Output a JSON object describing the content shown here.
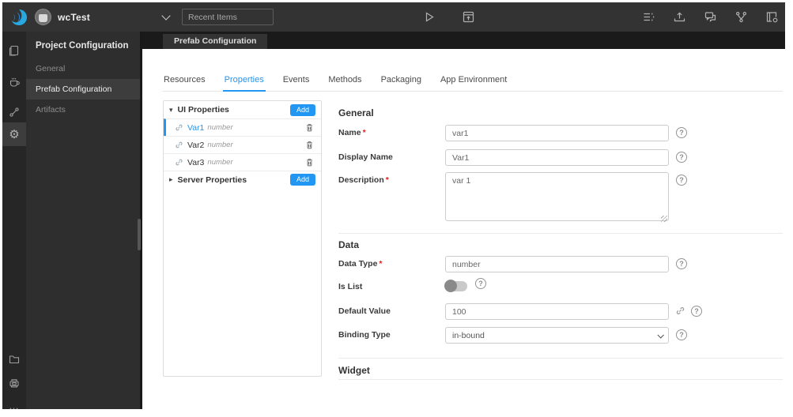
{
  "colors": {
    "accent": "#2196f3",
    "required": "#e02020",
    "topbar": "#333333",
    "rail": "#262626",
    "navpanel": "#2e2e2e",
    "tabstrip": "#1a1a1a"
  },
  "icons": {
    "help": "?",
    "more": "…",
    "gear": "⚙",
    "tri_down": "▾",
    "tri_right": "▸"
  },
  "topbar": {
    "project_name": "wcTest",
    "recent_placeholder": "Recent Items"
  },
  "config_nav": {
    "title": "Project Configuration",
    "items": [
      {
        "label": "General"
      },
      {
        "label": "Prefab Configuration"
      },
      {
        "label": "Artifacts"
      }
    ]
  },
  "workspace": {
    "open_tab": "Prefab Configuration",
    "tabs": [
      {
        "label": "Resources"
      },
      {
        "label": "Properties"
      },
      {
        "label": "Events"
      },
      {
        "label": "Methods"
      },
      {
        "label": "Packaging"
      },
      {
        "label": "App Environment"
      }
    ]
  },
  "properties_panel": {
    "groups": [
      {
        "label": "UI Properties",
        "add_label": "Add",
        "items": [
          {
            "name": "Var1",
            "type": "number"
          },
          {
            "name": "Var2",
            "type": "number"
          },
          {
            "name": "Var3",
            "type": "number"
          }
        ]
      },
      {
        "label": "Server Properties",
        "add_label": "Add",
        "items": []
      }
    ]
  },
  "form": {
    "required_marker": "*",
    "general": {
      "title": "General",
      "name": {
        "label": "Name",
        "value": "var1"
      },
      "display_name": {
        "label": "Display Name",
        "value": "Var1"
      },
      "description": {
        "label": "Description",
        "value": "var 1"
      }
    },
    "data": {
      "title": "Data",
      "data_type": {
        "label": "Data Type",
        "value": "number"
      },
      "is_list": {
        "label": "Is List",
        "enabled": false
      },
      "default_value": {
        "label": "Default Value",
        "value": "100"
      },
      "binding_type": {
        "label": "Binding Type",
        "value": "in-bound"
      }
    },
    "widget": {
      "title": "Widget"
    }
  }
}
